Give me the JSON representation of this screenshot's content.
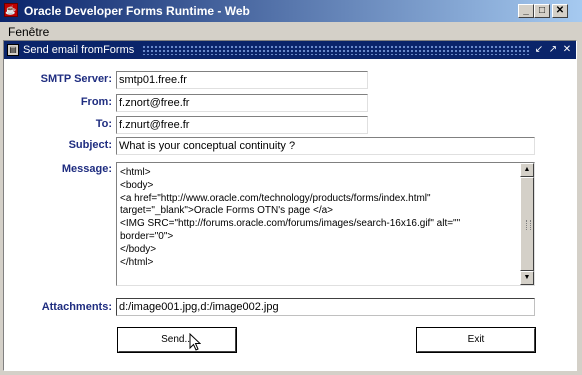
{
  "window": {
    "title": "Oracle Developer Forms Runtime - Web"
  },
  "menu": {
    "items": [
      "Fenêtre"
    ]
  },
  "form": {
    "title": "Send email fromForms",
    "smtp": {
      "label": "SMTP Server:",
      "value": "smtp01.free.fr"
    },
    "from": {
      "label": "From:",
      "value": "f.znort@free.fr"
    },
    "to": {
      "label": "To:",
      "value": "f.znurt@free.fr"
    },
    "subject": {
      "label": "Subject:",
      "value": "What is your conceptual continuity ?"
    },
    "message": {
      "label": "Message:",
      "value": "<html>\n<body>\n<a href=\"http://www.oracle.com/technology/products/forms/index.html\" target=\"_blank\">Oracle Forms OTN's page </a>\n<IMG SRC=\"http://forums.oracle.com/forums/images/search-16x16.gif\" alt=\"\" border=\"0\">\n</body>\n</html>"
    },
    "attachments": {
      "label": "Attachments:",
      "value": "d:/image001.jpg,d:/image002.jpg"
    },
    "send_label": "Send...",
    "exit_label": "Exit"
  }
}
